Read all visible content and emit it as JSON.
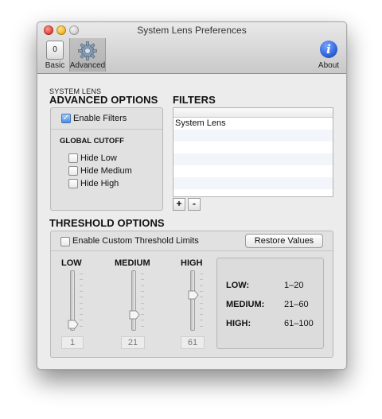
{
  "window": {
    "title": "System Lens Preferences"
  },
  "toolbar": {
    "basic_label": "Basic",
    "basic_icon_glyph": "0",
    "advanced_label": "Advanced",
    "about_label": "About",
    "about_icon_glyph": "i"
  },
  "advanced": {
    "small_heading": "SYSTEM LENS",
    "heading": "ADVANCED OPTIONS",
    "enable_filters": {
      "label": "Enable Filters",
      "checked": true
    },
    "global_cutoff": {
      "heading": "GLOBAL CUTOFF",
      "options": [
        {
          "label": "Hide Low",
          "checked": false
        },
        {
          "label": "Hide Medium",
          "checked": false
        },
        {
          "label": "Hide High",
          "checked": false
        }
      ]
    }
  },
  "filters": {
    "heading": "FILTERS",
    "items": [
      "System Lens"
    ],
    "add_label": "+",
    "remove_label": "-"
  },
  "threshold": {
    "heading": "THRESHOLD OPTIONS",
    "enable_custom": {
      "label": "Enable Custom Threshold Limits",
      "checked": false
    },
    "restore_label": "Restore Values",
    "sliders": [
      {
        "label": "LOW",
        "value": "1",
        "level": 0.0
      },
      {
        "label": "MEDIUM",
        "value": "21",
        "level": 0.2
      },
      {
        "label": "HIGH",
        "value": "61",
        "level": 0.6
      }
    ],
    "ranges": [
      {
        "label": "LOW:",
        "range": "1–20"
      },
      {
        "label": "MEDIUM:",
        "range": "21–60"
      },
      {
        "label": "HIGH:",
        "range": "61–100"
      }
    ]
  },
  "colors": {
    "checkbox_checked": "#4a8fe0",
    "about_icon": "#2d5fd6",
    "close": "#e0443a",
    "minimize": "#f0b428"
  }
}
